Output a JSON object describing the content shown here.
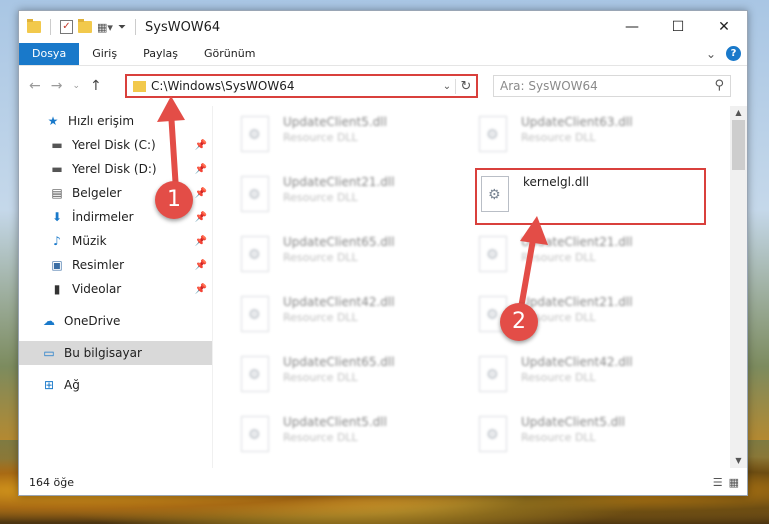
{
  "window": {
    "title": "SysWOW64",
    "minimize": "—",
    "maximize": "☐",
    "close": "✕"
  },
  "ribbon": {
    "tabs": [
      "Dosya",
      "Giriş",
      "Paylaş",
      "Görünüm"
    ],
    "active_tab": "Dosya",
    "expand": "⌄",
    "help": "?"
  },
  "address": {
    "path": "C:\\Windows\\SysWOW64",
    "search_placeholder": "Ara: SysWOW64"
  },
  "sidebar": {
    "items": [
      {
        "label": "Hızlı erişim",
        "icon": "star-icon",
        "pinned": false
      },
      {
        "label": "Yerel Disk (C:)",
        "icon": "drive-icon",
        "pinned": true
      },
      {
        "label": "Yerel Disk (D:)",
        "icon": "drive-icon",
        "pinned": true
      },
      {
        "label": "Belgeler",
        "icon": "documents-icon",
        "pinned": true
      },
      {
        "label": "İndirmeler",
        "icon": "download-icon",
        "pinned": true
      },
      {
        "label": "Müzik",
        "icon": "music-icon",
        "pinned": true
      },
      {
        "label": "Resimler",
        "icon": "pictures-icon",
        "pinned": true
      },
      {
        "label": "Videolar",
        "icon": "videos-icon",
        "pinned": true
      },
      {
        "label": "OneDrive",
        "icon": "cloud-icon",
        "pinned": false
      },
      {
        "label": "Bu bilgisayar",
        "icon": "computer-icon",
        "pinned": false,
        "selected": true
      },
      {
        "label": "Ağ",
        "icon": "network-icon",
        "pinned": false
      }
    ]
  },
  "files": {
    "left": [
      {
        "name": "UpdateClient5.dll",
        "type": "Resource DLL"
      },
      {
        "name": "UpdateClient21.dll",
        "type": "Resource DLL"
      },
      {
        "name": "UpdateClient65.dll",
        "type": "Resource DLL"
      },
      {
        "name": "UpdateClient42.dll",
        "type": "Resource DLL"
      },
      {
        "name": "UpdateClient65.dll",
        "type": "Resource DLL"
      },
      {
        "name": "UpdateClient5.dll",
        "type": "Resource DLL"
      }
    ],
    "right": [
      {
        "name": "UpdateClient63.dll",
        "type": "Resource DLL"
      },
      {
        "name": "kernelgl.dll",
        "type": ""
      },
      {
        "name": "UpdateClient21.dll",
        "type": "Resource DLL"
      },
      {
        "name": "UpdateClient21.dll",
        "type": "Resource DLL"
      },
      {
        "name": "UpdateClient42.dll",
        "type": "Resource DLL"
      },
      {
        "name": "UpdateClient5.dll",
        "type": "Resource DLL"
      }
    ]
  },
  "annotations": {
    "step1": "1",
    "step2": "2",
    "accent": "#d9403c"
  },
  "status": {
    "item_count": "164 öğe"
  }
}
